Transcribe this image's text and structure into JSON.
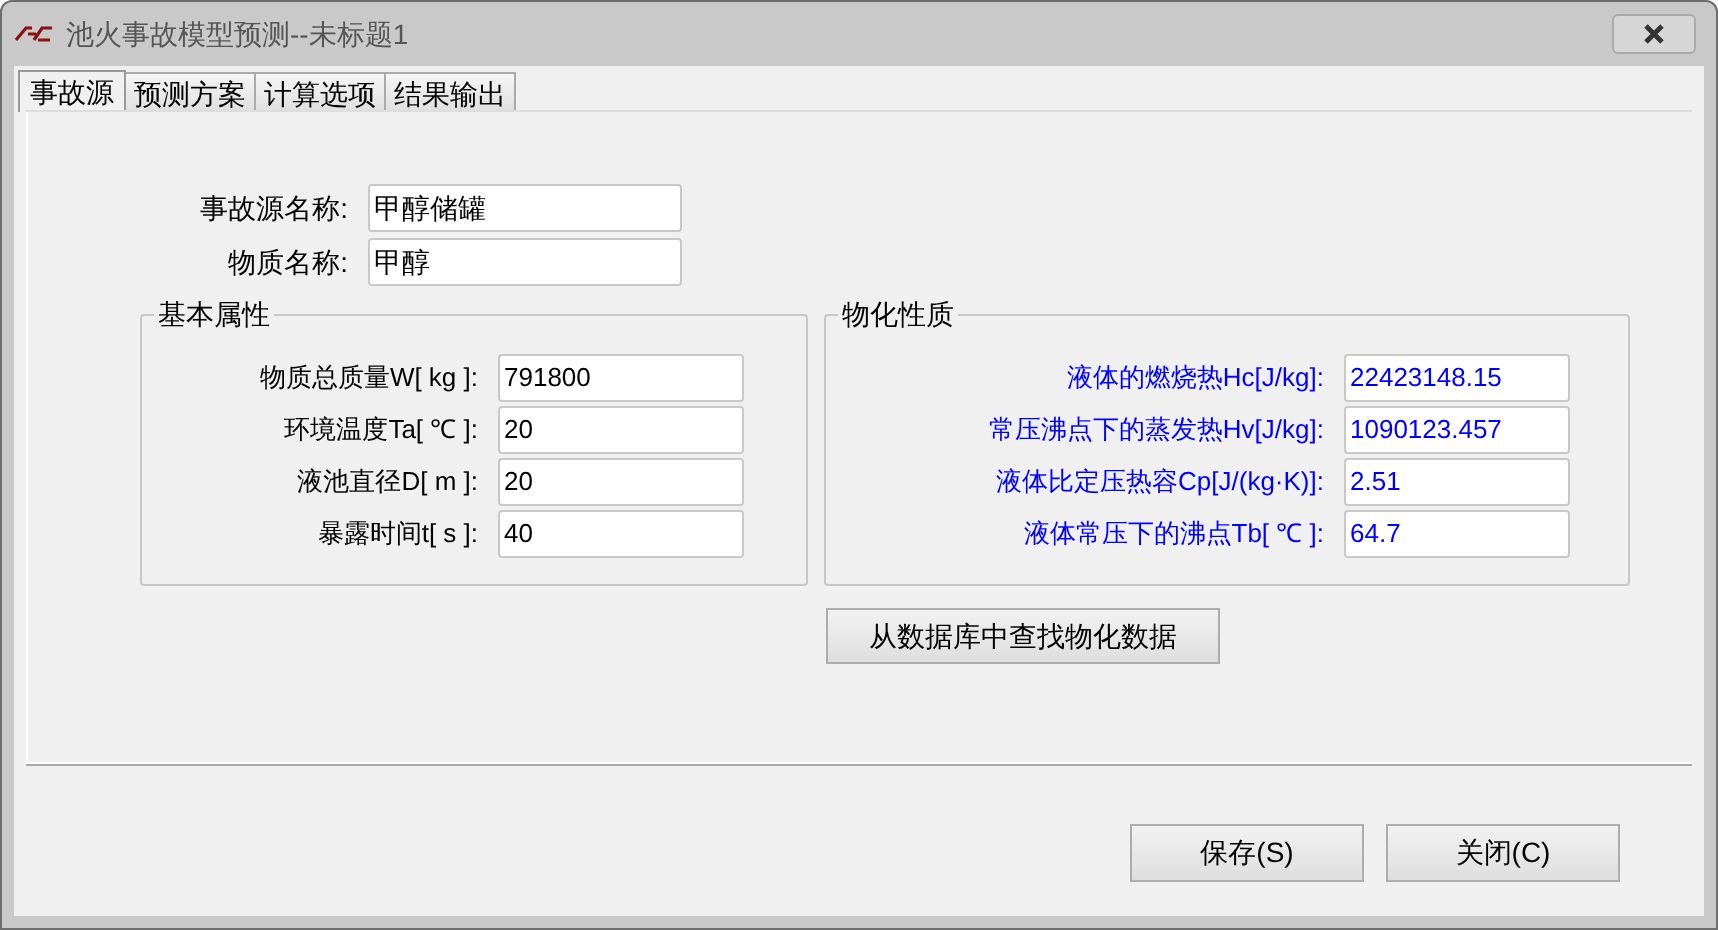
{
  "window": {
    "title": "池火事故模型预测--未标题1"
  },
  "tabs": [
    {
      "label": "事故源",
      "selected": true
    },
    {
      "label": "预测方案",
      "selected": false
    },
    {
      "label": "计算选项",
      "selected": false
    },
    {
      "label": "结果输出",
      "selected": false
    }
  ],
  "source_fields": [
    {
      "label": "事故源名称:",
      "value": "甲醇储罐"
    },
    {
      "label": "物质名称:",
      "value": "甲醇"
    }
  ],
  "basic_properties": {
    "title": "基本属性",
    "rows": [
      {
        "label": "物质总质量W[ kg ]:",
        "value": "791800"
      },
      {
        "label": "环境温度Ta[ ℃ ]:",
        "value": "20"
      },
      {
        "label": "液池直径D[  m ]:",
        "value": "20"
      },
      {
        "label": "暴露时间t[ s ]:",
        "value": "40"
      }
    ]
  },
  "physicochemical_properties": {
    "title": "物化性质",
    "rows": [
      {
        "label": "液体的燃烧热Hc[J/kg]:",
        "value": "22423148.15"
      },
      {
        "label": "常压沸点下的蒸发热Hv[J/kg]:",
        "value": "1090123.457"
      },
      {
        "label": "液体比定压热容Cp[J/(kg·K)]:",
        "value": "2.51"
      },
      {
        "label": "液体常压下的沸点Tb[ ℃ ]:",
        "value": "64.7"
      }
    ]
  },
  "lookup_button": "从数据库中查找物化数据",
  "buttons": [
    "保存(S)",
    "关闭(C)"
  ]
}
